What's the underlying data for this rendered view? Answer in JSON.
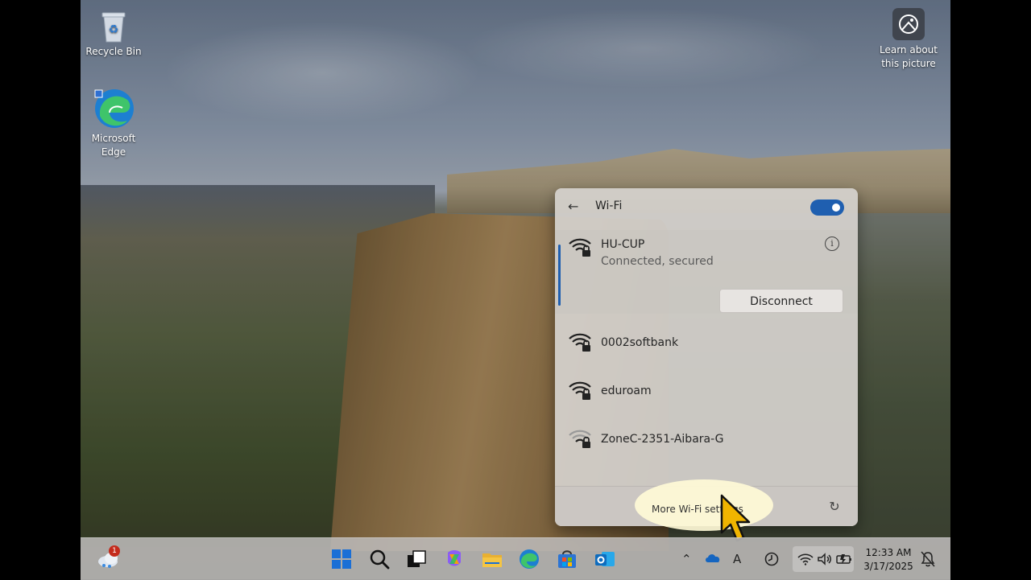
{
  "desktop": {
    "icons": [
      {
        "label": "Recycle Bin",
        "icon": "recycle-bin-icon"
      },
      {
        "label": "Microsoft Edge",
        "icon": "edge-icon"
      }
    ],
    "learn_picture": {
      "label": "Learn about this picture",
      "icon": "camera-icon"
    }
  },
  "wifi_panel": {
    "title": "Wi-Fi",
    "toggle_on": true,
    "connected": {
      "ssid": "HU-CUP",
      "status": "Connected, secured",
      "button": "Disconnect"
    },
    "networks": [
      {
        "ssid": "0002softbank",
        "secured": true,
        "signal": "strong"
      },
      {
        "ssid": "eduroam",
        "secured": true,
        "signal": "strong"
      },
      {
        "ssid": "ZoneC-2351-Aibara-G",
        "secured": true,
        "signal": "weak"
      }
    ],
    "footer": {
      "more_settings": "More Wi-Fi settings"
    }
  },
  "taskbar": {
    "widgets_badge": "1",
    "apps": [
      "start-icon",
      "search-icon",
      "task-view-icon",
      "copilot-icon",
      "file-explorer-icon",
      "edge-icon",
      "store-icon",
      "outlook-icon"
    ],
    "tray": [
      "chevron-up-icon",
      "onedrive-icon",
      "ime-icon",
      "sync-icon",
      "wifi-icon",
      "volume-icon",
      "battery-icon"
    ],
    "time": "12:33 AM",
    "date": "3/17/2025"
  },
  "colors": {
    "accent": "#1f5fb0",
    "panel_bg": "#d6d2ce",
    "highlight": "#fffad7",
    "cursor": "#f0b400"
  }
}
